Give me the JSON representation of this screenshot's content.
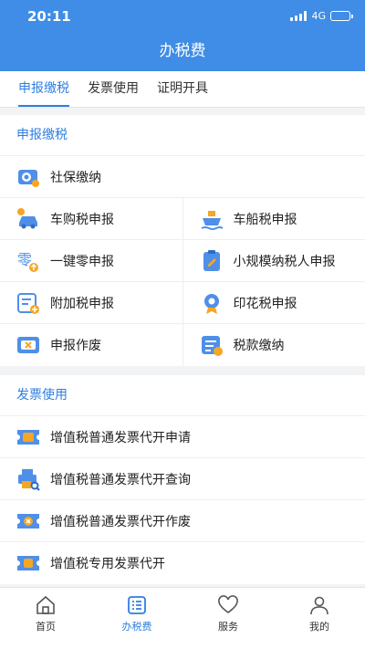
{
  "status": {
    "time": "20:11",
    "network": "4G"
  },
  "nav": {
    "title": "办税费"
  },
  "tabs": [
    {
      "label": "申报缴税",
      "active": true
    },
    {
      "label": "发票使用",
      "active": false
    },
    {
      "label": "证明开具",
      "active": false
    }
  ],
  "sections": {
    "declare": {
      "title": "申报缴税",
      "items": {
        "social": "社保缴纳",
        "car_tax": "车购税申报",
        "ship_tax": "车船税申报",
        "zero": "一键零申报",
        "small": "小规模纳税人申报",
        "surtax": "附加税申报",
        "stamp": "印花税申报",
        "void": "申报作废",
        "pay": "税款缴纳"
      }
    },
    "invoice": {
      "title": "发票使用",
      "items": {
        "vat_apply": "增值税普通发票代开申请",
        "vat_query": "增值税普通发票代开查询",
        "vat_void": "增值税普通发票代开作废",
        "vat_special": "增值税专用发票代开"
      }
    }
  },
  "bottom_nav": {
    "home": "首页",
    "tax": "办税费",
    "service": "服务",
    "mine": "我的"
  },
  "colors": {
    "primary": "#3f8de6",
    "accent": "#2f7fe0",
    "icon_orange": "#f5a623"
  }
}
